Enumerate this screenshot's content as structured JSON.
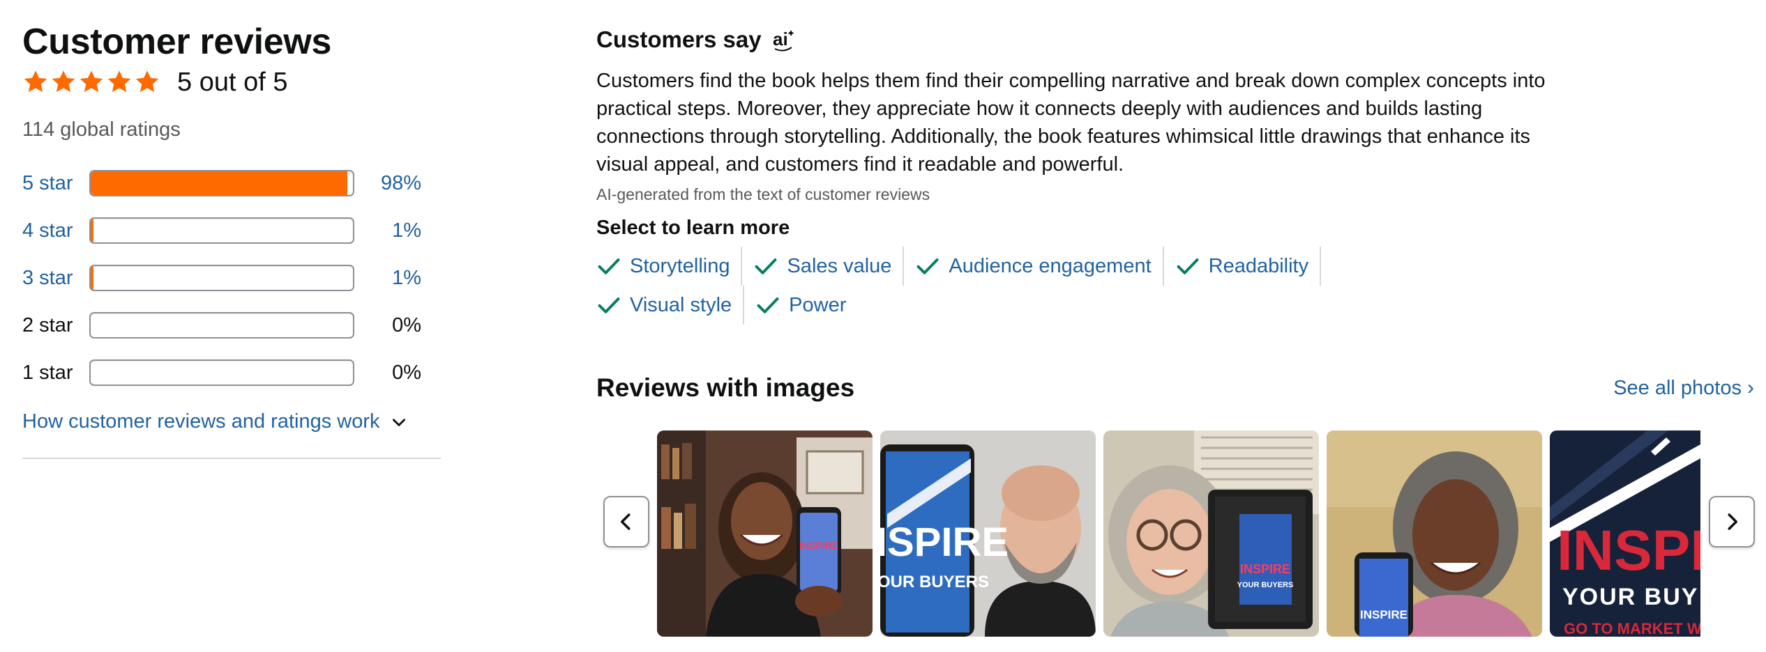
{
  "header": {
    "title": "Customer reviews",
    "rating_text": "5 out of 5",
    "global_ratings": "114 global ratings"
  },
  "histogram": [
    {
      "label": "5 star",
      "pct": "98%",
      "fraction": 0.98,
      "linked": true
    },
    {
      "label": "4 star",
      "pct": "1%",
      "fraction": 0.01,
      "linked": true
    },
    {
      "label": "3 star",
      "pct": "1%",
      "fraction": 0.01,
      "linked": true
    },
    {
      "label": "2 star",
      "pct": "0%",
      "fraction": 0.0,
      "linked": false
    },
    {
      "label": "1 star",
      "pct": "0%",
      "fraction": 0.0,
      "linked": false
    }
  ],
  "how_link": "How customer reviews and ratings work",
  "customers_say": {
    "heading": "Customers say",
    "summary": "Customers find the book helps them find their compelling narrative and break down complex concepts into practical steps. Moreover, they appreciate how it connects deeply with audiences and builds lasting connections through storytelling. Additionally, the book features whimsical little drawings that enhance its visual appeal, and customers find it readable and powerful.",
    "ai_note": "AI-generated from the text of customer reviews",
    "select_label": "Select to learn more",
    "aspects": [
      "Storytelling",
      "Sales value",
      "Audience engagement",
      "Readability",
      "Visual style",
      "Power"
    ]
  },
  "reviews_images": {
    "title": "Reviews with images",
    "see_all": "See all photos",
    "book_cover_text": [
      "INSPIRE",
      "YOUR BUYERS"
    ],
    "large_cover_text": [
      "INSPIR",
      "YOUR BUY",
      "GO TO MARKET W"
    ]
  },
  "colors": {
    "star": "#ff6a00",
    "bar_fill": "#ff6a00",
    "link": "#2162a1",
    "check": "#067d62",
    "muted": "#565959"
  },
  "icons": {
    "star": "star-icon",
    "chevron_down": "chevron-down-icon",
    "ai": "ai-sparkle-icon",
    "check": "check-icon",
    "prev": "chevron-left-icon",
    "next": "chevron-right-icon"
  }
}
